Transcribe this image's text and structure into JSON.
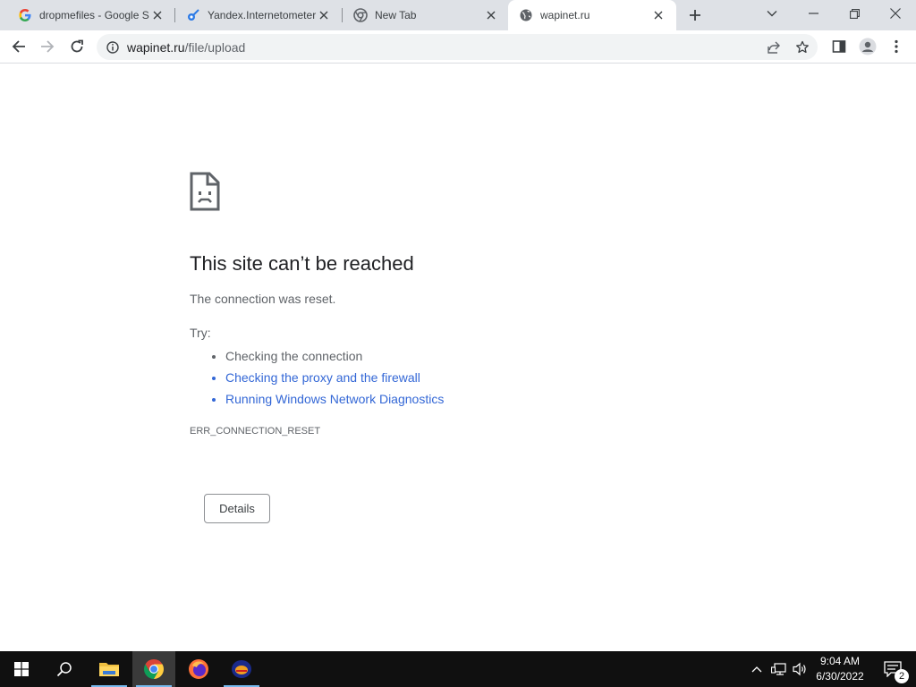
{
  "tabs": [
    {
      "title": "dropmefiles - Google S",
      "favicon": "google-g-icon"
    },
    {
      "title": "Yandex.Internetometer",
      "favicon": "yandex-rocket-icon"
    },
    {
      "title": "New Tab",
      "favicon": "chrome-icon"
    },
    {
      "title": "wapinet.ru",
      "favicon": "globe-icon",
      "active": true
    }
  ],
  "address_bar": {
    "host": "wapinet.ru",
    "path": "/file/upload"
  },
  "error": {
    "title": "This site can’t be reached",
    "description": "The connection was reset.",
    "try_label": "Try:",
    "suggestions": [
      {
        "text": "Checking the connection",
        "link": false
      },
      {
        "text": "Checking the proxy and the firewall",
        "link": true
      },
      {
        "text": "Running Windows Network Diagnostics",
        "link": true
      }
    ],
    "code": "ERR_CONNECTION_RESET",
    "details_button": "Details"
  },
  "taskbar": {
    "time": "9:04 AM",
    "date": "6/30/2022",
    "notification_count": "2"
  },
  "colors": {
    "link": "#3367d6",
    "tabstrip": "#dee1e6",
    "taskbar": "#101010"
  }
}
